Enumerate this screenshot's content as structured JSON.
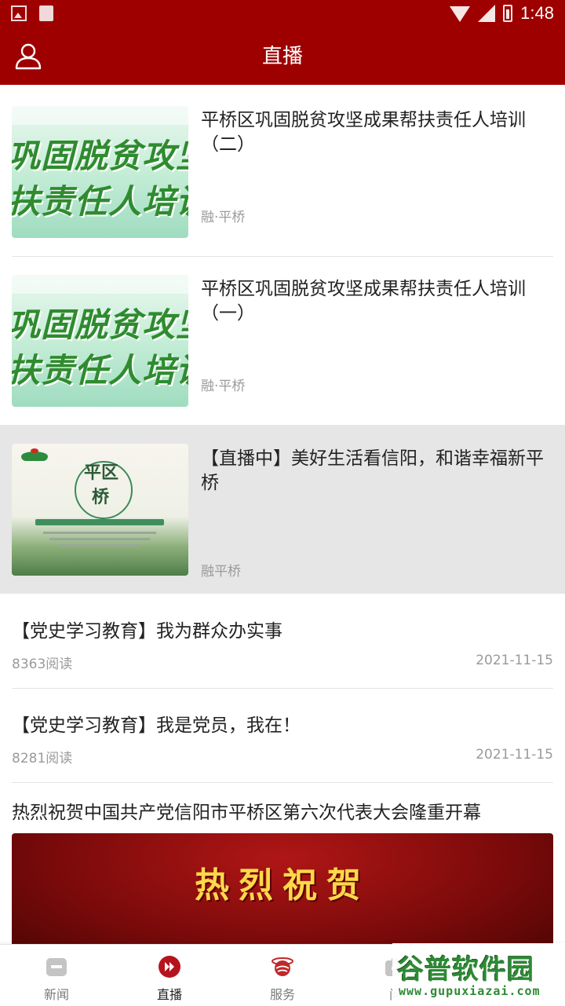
{
  "status_bar": {
    "time": "1:48"
  },
  "app_bar": {
    "title": "直播"
  },
  "live_cards": [
    {
      "title": "平桥区巩固脱贫攻坚成果帮扶责任人培训（二）",
      "source": "融·平桥",
      "thumb_line1": "巩固脱贫攻坚",
      "thumb_line2": "扶责任人培训"
    },
    {
      "title": "平桥区巩固脱贫攻坚成果帮扶责任人培训（一）",
      "source": "融·平桥",
      "thumb_line1": "巩固脱贫攻坚",
      "thumb_line2": "扶责任人培训"
    },
    {
      "title": "【直播中】美好生活看信阳，和谐幸福新平桥",
      "source": "融平桥",
      "thumb_brush1": "平区",
      "thumb_brush2": "桥"
    }
  ],
  "articles": [
    {
      "title": "【党史学习教育】我为群众办实事",
      "reads": "8363阅读",
      "date": "2021-11-15"
    },
    {
      "title": "【党史学习教育】我是党员，我在！",
      "reads": "8281阅读",
      "date": "2021-11-15"
    }
  ],
  "banner_article": {
    "title": "热烈祝贺中国共产党信阳市平桥区第六次代表大会隆重开幕",
    "banner_text": "热烈祝贺"
  },
  "bottom_nav": [
    {
      "label": "新闻",
      "icon": "news-icon",
      "active": false
    },
    {
      "label": "直播",
      "icon": "live-play-icon",
      "active": true
    },
    {
      "label": "服务",
      "icon": "service-icon",
      "active": false
    },
    {
      "label": "问",
      "icon": "camera-icon",
      "active": false
    }
  ],
  "watermark": {
    "logo": "谷普软件园",
    "url": "www.gupuxiazai.com"
  },
  "colors": {
    "brand_red": "#9e0000",
    "text_dark": "#222222",
    "text_muted": "#9a9a9a",
    "live_card_bg": "#e6e6e6"
  }
}
